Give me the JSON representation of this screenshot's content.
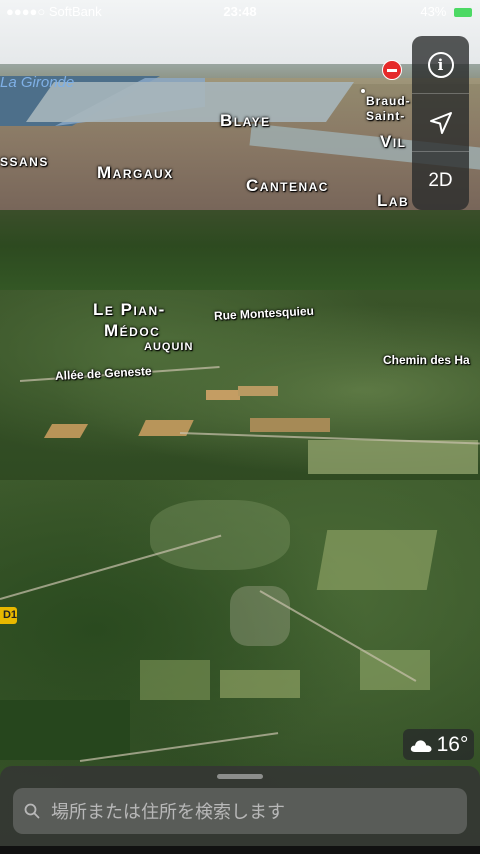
{
  "status_bar": {
    "carrier": "●●●●○ SoftBank",
    "time": "23:48",
    "battery": "43%"
  },
  "map": {
    "labels": {
      "gironde": "La Gironde",
      "blaye": "Blaye",
      "braud": "Braud-",
      "saint": "Saint-",
      "villeneuve": "Vil",
      "ssans": "ssans",
      "margaux": "Margaux",
      "cantenac": "Cantenac",
      "labarde": "Lab",
      "le_pian": "Le Pian-",
      "medoc": "Médoc",
      "auquin": "AUQUIN",
      "rue_montesquieu": "Rue Montesquieu",
      "chemin_des_ha": "Chemin des Ha",
      "allee_de_geneste": "Allée de Geneste"
    },
    "road_badge": "D1",
    "colors": {
      "water_label": "#7fb0e6",
      "road_badge": "#e8b800",
      "no_entry": "#e52a2a"
    }
  },
  "controls": {
    "info_label": "i",
    "view_mode": "2D"
  },
  "weather": {
    "temperature": "16°",
    "icon": "cloud-icon"
  },
  "search": {
    "placeholder": "場所または住所を検索します"
  }
}
